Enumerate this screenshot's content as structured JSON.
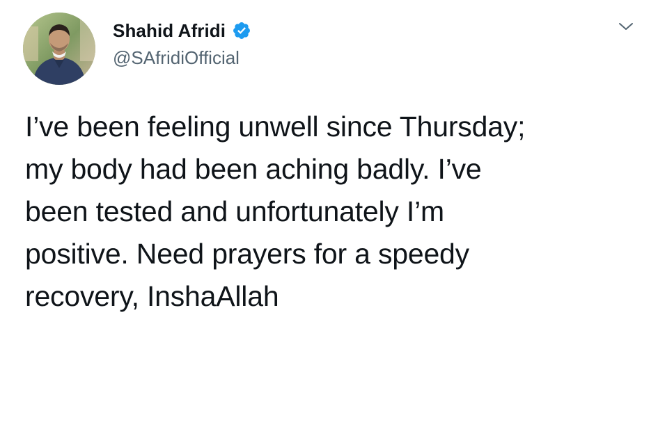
{
  "tweet": {
    "author": {
      "display_name": "Shahid Afridi",
      "handle": "@SAfridiOfficial",
      "verified": true,
      "avatar_icon": "profile-photo",
      "verified_icon": "verified-badge-icon"
    },
    "menu_icon": "chevron-down-icon",
    "text": "I’ve been feeling unwell since Thursday;\nmy body had been aching badly. I’ve\nbeen tested and unfortunately I’m\npositive. Need prayers for a speedy\nrecovery, InshaAllah"
  },
  "colors": {
    "text_primary": "#0f1419",
    "text_secondary": "#536471",
    "verified_blue": "#1d9bf0",
    "background": "#ffffff"
  }
}
